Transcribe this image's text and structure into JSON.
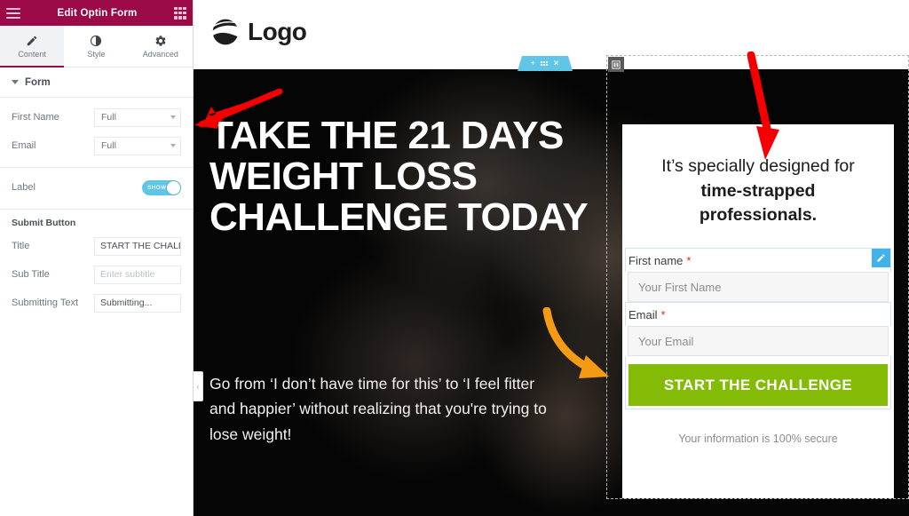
{
  "panel": {
    "header": {
      "title": "Edit Optin Form",
      "menu_icon": "hamburger-icon",
      "apps_icon": "grid-icon"
    },
    "tabs": [
      {
        "label": "Content",
        "icon": "pencil-icon",
        "active": true
      },
      {
        "label": "Style",
        "icon": "contrast-icon",
        "active": false
      },
      {
        "label": "Advanced",
        "icon": "gear-icon",
        "active": false
      }
    ],
    "section": {
      "title": "Form",
      "expanded": true
    },
    "controls": [
      {
        "label": "First Name",
        "type": "select",
        "value": "Full"
      },
      {
        "label": "Email",
        "type": "select",
        "value": "Full"
      },
      {
        "label": "Label",
        "type": "toggle",
        "value": "SHOW",
        "on": true
      }
    ],
    "submit_group": {
      "title": "Submit Button",
      "fields": [
        {
          "label": "Title",
          "value": "START THE CHALLE",
          "placeholder": ""
        },
        {
          "label": "Sub Title",
          "value": "",
          "placeholder": "Enter subtitle"
        },
        {
          "label": "Submitting Text",
          "value": "Submitting...",
          "placeholder": ""
        }
      ]
    },
    "collapse_tab": "‹"
  },
  "preview": {
    "site_header": {
      "logo_text": "Logo",
      "logo_icon": "sphere-logo-icon"
    },
    "section_toolbar": {
      "add_icon": "plus-icon",
      "drag_icon": "drag-dots-icon",
      "close_icon": "close-icon"
    },
    "hero": {
      "headline": "TAKE THE 21 DAYS WEIGHT LOSS CHALLENGE TODAY",
      "subcopy": "Go from ‘I don’t have time for this’ to ‘I feel fitter and happier’ without realizing that you're trying to lose weight!"
    },
    "optin": {
      "widget_handle_icon": "column-handle-icon",
      "heading_line1": "It’s specially designed for",
      "heading_line2": "time-strapped professionals.",
      "fields": [
        {
          "label": "First name",
          "required": "*",
          "placeholder": "Your First Name",
          "edit_icon": "pencil-icon"
        },
        {
          "label": "Email",
          "required": "*",
          "placeholder": "Your Email"
        }
      ],
      "submit_label": "START THE CHALLENGE",
      "secure_note": "Your information is 100% secure"
    }
  },
  "annotations": {
    "arrow_panel": "red-arrow-pointing-left-at-first-name-dropdown",
    "arrow_form": "red-arrow-pointing-down-at-optin-heading",
    "arrow_curve": "orange-curved-arrow-pointing-to-form"
  },
  "colors": {
    "brand_crimson": "#9b0a46",
    "accent_blue": "#60c6e8",
    "submit_green": "#84bb07",
    "required_red": "#e02b2b",
    "annotation_red": "#f50000",
    "annotation_orange": "#f59a13"
  }
}
